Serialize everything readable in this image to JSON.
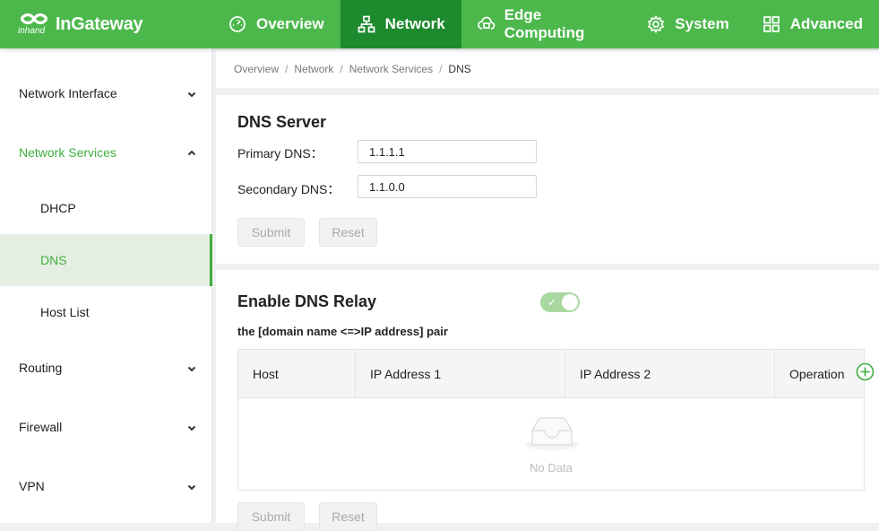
{
  "brand": {
    "name": "InGateway",
    "sub": "inhand"
  },
  "nav": [
    {
      "label": "Overview",
      "icon": "dashboard-icon"
    },
    {
      "label": "Network",
      "icon": "network-tree-icon"
    },
    {
      "label": "Edge Computing",
      "icon": "cloud-chip-icon"
    },
    {
      "label": "System",
      "icon": "gear-icon"
    },
    {
      "label": "Advanced",
      "icon": "grid-icon"
    }
  ],
  "sidebar": {
    "items": [
      {
        "label": "Network Interface"
      },
      {
        "label": "Network Services"
      },
      {
        "label": "DHCP"
      },
      {
        "label": "DNS"
      },
      {
        "label": "Host List"
      },
      {
        "label": "Routing"
      },
      {
        "label": "Firewall"
      },
      {
        "label": "VPN"
      }
    ]
  },
  "breadcrumb": [
    "Overview",
    "Network",
    "Network Services",
    "DNS"
  ],
  "dns_server": {
    "title": "DNS Server",
    "primary_label": "Primary DNS：",
    "primary_value": "1.1.1.1",
    "secondary_label": "Secondary DNS：",
    "secondary_value": "1.1.0.0",
    "submit": "Submit",
    "reset": "Reset"
  },
  "relay": {
    "title": "Enable DNS Relay",
    "enabled": true,
    "pair_label": "the [domain name <=>IP address] pair",
    "columns": [
      "Host",
      "IP Address 1",
      "IP Address 2",
      "Operation"
    ],
    "empty_text": "No Data",
    "submit": "Submit",
    "reset": "Reset"
  },
  "colors": {
    "brand_green": "#4cb84c",
    "nav_active": "#1d8a2e",
    "accent": "#3fae3f",
    "selected_bg": "#e4efe2"
  }
}
